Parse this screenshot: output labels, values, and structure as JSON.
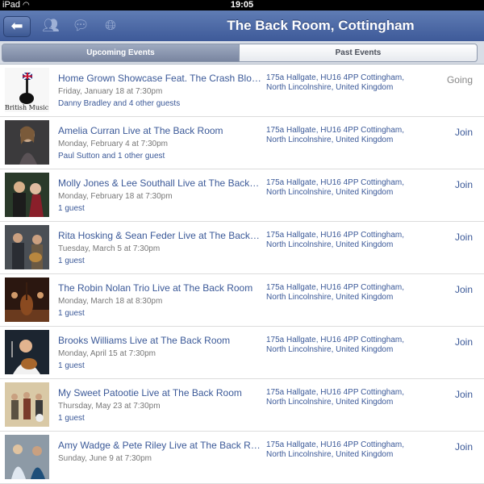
{
  "status": {
    "carrier": "iPad",
    "time": "19:05"
  },
  "nav": {
    "title": "The Back Room, Cottingham"
  },
  "tabs": {
    "upcoming": "Upcoming Events",
    "past": "Past Events"
  },
  "events": [
    {
      "title": "Home Grown Showcase Feat. The Crash Blosso...",
      "date": "Friday, January 18 at 7:30pm",
      "guests_name": "Danny Bradley",
      "guests_rest": " and 4 other guests",
      "address": "175a Hallgate, HU16 4PP Cottingham, North Lincolnshire, United Kingdom",
      "action": "Going",
      "thumb_caption": "British Music"
    },
    {
      "title": "Amelia Curran Live at The Back Room",
      "date": "Monday, February 4 at 7:30pm",
      "guests_name": "Paul Sutton",
      "guests_rest": " and 1 other guest",
      "address": "175a Hallgate, HU16 4PP Cottingham, North Lincolnshire, United Kingdom",
      "action": "Join"
    },
    {
      "title": "Molly Jones & Lee Southall Live at The Back Room",
      "date": "Monday, February 18 at 7:30pm",
      "guests_name": "",
      "guests_rest": "1 guest",
      "address": "175a Hallgate, HU16 4PP Cottingham, North Lincolnshire, United Kingdom",
      "action": "Join"
    },
    {
      "title": "Rita Hosking & Sean Feder Live at The Back Room",
      "date": "Tuesday, March 5 at 7:30pm",
      "guests_name": "",
      "guests_rest": "1 guest",
      "address": "175a Hallgate, HU16 4PP Cottingham, North Lincolnshire, United Kingdom",
      "action": "Join"
    },
    {
      "title": "The Robin Nolan Trio Live at The Back Room",
      "date": "Monday, March 18 at 8:30pm",
      "guests_name": "",
      "guests_rest": "1 guest",
      "address": "175a Hallgate, HU16 4PP Cottingham, North Lincolnshire, United Kingdom",
      "action": "Join"
    },
    {
      "title": "Brooks Williams Live at The Back Room",
      "date": "Monday, April 15 at 7:30pm",
      "guests_name": "",
      "guests_rest": "1 guest",
      "address": "175a Hallgate, HU16 4PP Cottingham, North Lincolnshire, United Kingdom",
      "action": "Join"
    },
    {
      "title": "My Sweet Patootie Live at The Back Room",
      "date": "Thursday, May 23 at 7:30pm",
      "guests_name": "",
      "guests_rest": "1 guest",
      "address": "175a Hallgate, HU16 4PP Cottingham, North Lincolnshire, United Kingdom",
      "action": "Join"
    },
    {
      "title": "Amy Wadge & Pete Riley Live at The Back Room",
      "date": "Sunday, June 9 at 7:30pm",
      "guests_name": "",
      "guests_rest": "",
      "address": "175a Hallgate, HU16 4PP Cottingham, North Lincolnshire, United Kingdom",
      "action": "Join"
    }
  ],
  "colors": {
    "brand": "#3b5998",
    "navbar": "#4b67a3"
  }
}
